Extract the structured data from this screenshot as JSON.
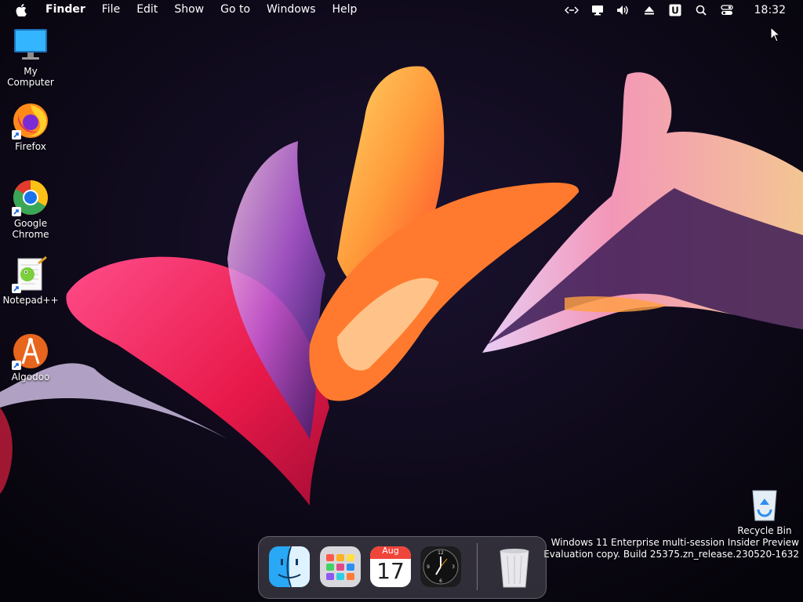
{
  "menubar": {
    "app_name": "Finder",
    "menus": [
      "File",
      "Edit",
      "Show",
      "Go to",
      "Windows",
      "Help"
    ],
    "clock": "18:32",
    "status_icons": [
      "code-arrows-icon",
      "display-icon",
      "volume-icon",
      "eject-icon",
      "u-app-icon",
      "search-icon",
      "control-center-icon"
    ]
  },
  "desktop": {
    "icons": [
      {
        "label": "My Computer",
        "icon": "monitor-icon"
      },
      {
        "label": "Firefox",
        "icon": "firefox-icon"
      },
      {
        "label": "Google Chrome",
        "icon": "chrome-icon"
      },
      {
        "label": "Notepad++",
        "icon": "notepadpp-icon"
      },
      {
        "label": "Algodoo",
        "icon": "algodoo-icon"
      }
    ],
    "recycle_bin": {
      "label": "Recycle Bin"
    }
  },
  "watermark": {
    "line1": "Windows 11 Enterprise multi-session Insider Preview",
    "line2": "Evaluation copy. Build 25375.zn_release.230520-1632"
  },
  "dock": {
    "items": [
      {
        "name": "Finder",
        "icon": "finder-icon"
      },
      {
        "name": "Launchpad",
        "icon": "launchpad-icon"
      },
      {
        "name": "Calendar",
        "icon": "calendar-icon",
        "month": "Aug",
        "day": "17"
      },
      {
        "name": "Clock",
        "icon": "clock-icon"
      },
      {
        "name": "Trash",
        "icon": "trash-icon"
      }
    ]
  },
  "colors": {
    "accent_blue": "#2f8ff0",
    "background": "#0a0712"
  }
}
